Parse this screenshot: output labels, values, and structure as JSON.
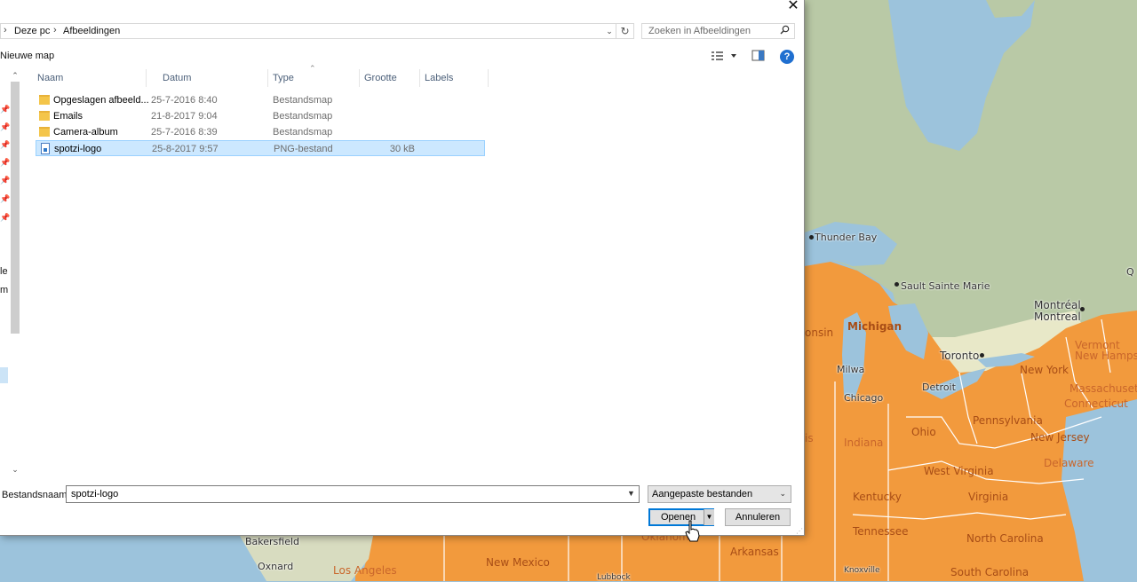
{
  "window": {
    "close_glyph": "✕"
  },
  "addressbar": {
    "crumbs": [
      "Deze pc",
      "Afbeeldingen"
    ],
    "separator": "›",
    "dropdown_glyph": "⌄",
    "refresh_glyph": "↻"
  },
  "search": {
    "placeholder": "Zoeken in Afbeeldingen",
    "icon": "search-icon"
  },
  "toolbar": {
    "new_folder_label": "Nieuwe map",
    "help_glyph": "?"
  },
  "nav": {
    "fragments": [
      "le",
      "m"
    ]
  },
  "columns": [
    "Naam",
    "Datum",
    "Type",
    "Grootte",
    "Labels"
  ],
  "files": [
    {
      "name": "Opgeslagen afbeeld...",
      "date": "25-7-2016 8:40",
      "type": "Bestandsmap",
      "size": "",
      "icon": "folder-icon"
    },
    {
      "name": "Emails",
      "date": "21-8-2017 9:04",
      "type": "Bestandsmap",
      "size": "",
      "icon": "folder-icon"
    },
    {
      "name": "Camera-album",
      "date": "25-7-2016 8:39",
      "type": "Bestandsmap",
      "size": "",
      "icon": "folder-icon"
    },
    {
      "name": "spotzi-logo",
      "date": "25-8-2017 9:57",
      "type": "PNG-bestand",
      "size": "30 kB",
      "icon": "png-file-icon",
      "selected": true
    }
  ],
  "footer": {
    "filename_label": "Bestandsnaam:",
    "filename_value": "spotzi-logo",
    "filter_value": "Aangepaste bestanden",
    "open_label": "Openen",
    "cancel_label": "Annuleren"
  },
  "map": {
    "cities": [
      "Thunder Bay",
      "Sault Sainte Marie",
      "Montréal",
      "Montreal",
      "Toronto",
      "Detroit",
      "Chicago",
      "Milwa",
      "Bakersfield",
      "Oxnard",
      "Los Angeles",
      "Lubbock",
      "Knoxville",
      "Q"
    ],
    "states": [
      "Michigan",
      "onsin",
      "Ohio",
      "Indiana",
      "Illinois",
      "West Virginia",
      "Virginia",
      "Kentucky",
      "Tennessee",
      "North Carolina",
      "South Carolina",
      "Pennsylvania",
      "New York",
      "New Jersey",
      "Delaware",
      "Connecticut",
      "Massachusetts",
      "New Hampshire",
      "Vermont",
      "Oklahoma",
      "Arkansas",
      "New Mexico",
      "is"
    ],
    "colors": {
      "water": "#9cc3dc",
      "land": "#b7c9a3",
      "us_fill": "#f29a3d",
      "borders": "#ffffff"
    }
  }
}
